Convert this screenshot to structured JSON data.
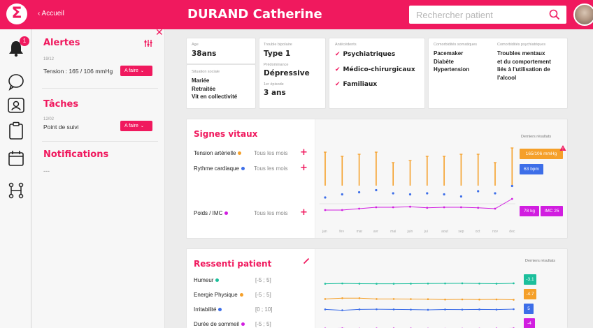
{
  "app": {
    "logo_glyph": "Σ",
    "breadcrumb": "‹ Accueil",
    "patient_name": "DURAND Catherine",
    "search_placeholder": "Rechercher patient",
    "accent_color": "#f0195e"
  },
  "rail": {
    "alert_badge": "1",
    "icons": [
      "bell-icon",
      "chat-bubble-icon",
      "contact-card-icon",
      "clipboard-icon",
      "calendar-icon",
      "pathway-icon"
    ]
  },
  "panel": {
    "close_glyph": "✕",
    "alertes_title": "Alertes",
    "alert_date": "19/12",
    "alert_text": "Tension : 165 / 106 mmHg",
    "todo_label": "A faire",
    "taches_title": "Tâches",
    "task_date": "12/02",
    "task_text": "Point de suivi",
    "notifications_title": "Notifications",
    "notifications_empty": "---"
  },
  "profile": {
    "age_label": "Age",
    "age_value": "38ans",
    "social_label": "Situation sociale",
    "social_lines": [
      "Mariée",
      "Retraitée",
      "Vit en collectivité"
    ],
    "trouble_label": "Trouble bipolaire",
    "trouble_value": "Type 1",
    "predominance_label": "Prédominance",
    "predominance_value": "Dépressive",
    "episode_label": "1er épisode",
    "episode_value": "3 ans",
    "antecedents_label": "Antécédents",
    "antecedents": [
      "Psychiatriques",
      "Médico-chirurgicaux",
      "Familiaux"
    ],
    "somatic_label": "Comorbidités somatiques",
    "somatic": [
      "Pacemaker",
      "Diabète",
      "Hypertension"
    ],
    "psych_label": "Comorbidités psychiatriques",
    "psych_lines": [
      "Troubles mentaux",
      "et du comportement",
      "liés à l'utilisation de",
      "l'alcool"
    ]
  },
  "vitals": {
    "title": "Signes vitaux",
    "latest_label": "Derniers résultats",
    "rows": [
      {
        "label": "Tension artérielle",
        "freq": "Tous les mois",
        "color": "#f5a02a"
      },
      {
        "label": "Rythme cardiaque",
        "freq": "Tous les mois",
        "color": "#3d6ee8"
      },
      {
        "label": "Poids / IMC",
        "freq": "Tous les mois",
        "color": "#d11ee0"
      }
    ],
    "plus_glyph": "+",
    "tension_tag": "165/106 mmHg",
    "heart_tag": "63 bpm",
    "weight_tag": "78 kg",
    "imc_tag": "IMC 25",
    "months": [
      "jan",
      "fev",
      "mar",
      "avr",
      "mai",
      "juin",
      "jui",
      "aout",
      "sep",
      "oct",
      "nov",
      "dec"
    ]
  },
  "ressenti": {
    "title": "Ressenti patient",
    "latest_label": "Derniers résultats",
    "rows": [
      {
        "label": "Humeur",
        "range": "[-5 ; 5]",
        "color": "#1cbf9c",
        "tag": "-3.1"
      },
      {
        "label": "Energie Physique",
        "range": "[-5 ; 5]",
        "color": "#f5a02a",
        "tag": "-4.7"
      },
      {
        "label": "Irritabilité",
        "range": "[0 ; 10]",
        "color": "#3d6ee8",
        "tag": "5"
      },
      {
        "label": "Durée de sommeil",
        "range": "[-5 ; 5]",
        "color": "#d11ee0",
        "tag": "-4"
      }
    ]
  },
  "chart_data": [
    {
      "type": "line",
      "title": "Signes vitaux",
      "categories": [
        "jan",
        "fev",
        "mar",
        "avr",
        "mai",
        "juin",
        "jui",
        "aout",
        "sep",
        "oct",
        "nov",
        "dec"
      ],
      "series": [
        {
          "name": "Tension artérielle",
          "values": [
            0.8,
            0.7,
            0.75,
            0.8,
            0.55,
            0.6,
            0.7,
            0.7,
            0.75,
            0.75,
            0.55,
            0.9
          ]
        },
        {
          "name": "Rythme cardiaque",
          "values": [
            0.1,
            0.25,
            0.35,
            0.45,
            0.3,
            0.25,
            0.3,
            0.25,
            0.15,
            0.4,
            0.3,
            0.65
          ]
        },
        {
          "name": "Poids / IMC",
          "values": [
            0.5,
            0.5,
            0.55,
            0.6,
            0.6,
            0.62,
            0.58,
            0.6,
            0.6,
            0.58,
            0.55,
            0.9
          ]
        }
      ]
    },
    {
      "type": "line",
      "title": "Ressenti patient",
      "categories": [
        "1",
        "2",
        "3",
        "4",
        "5",
        "6",
        "7",
        "8",
        "9",
        "10",
        "11",
        "12"
      ],
      "series": [
        {
          "name": "Humeur",
          "values": [
            -3.5,
            -3.2,
            -3.4,
            -3.5,
            -3.5,
            -3.4,
            -3.3,
            -3.2,
            -3.1,
            -3.3,
            -3.4,
            -3.1
          ]
        },
        {
          "name": "Energie Physique",
          "values": [
            -4.0,
            -3.3,
            -3.3,
            -4.0,
            -4.0,
            -4.1,
            -4.2,
            -4.5,
            -4.4,
            -4.5,
            -4.4,
            -4.7
          ]
        },
        {
          "name": "Irritabilité",
          "values": [
            4.8,
            4.0,
            4.8,
            4.9,
            4.8,
            4.6,
            4.4,
            4.7,
            4.6,
            4.8,
            4.6,
            5
          ]
        },
        {
          "name": "Durée de sommeil",
          "values": [
            -4.2,
            -4.0,
            -4.3,
            -4.2,
            -4.1,
            -4.2,
            -4.3,
            -4.4,
            -4.3,
            -4.3,
            -4.2,
            -4
          ]
        }
      ]
    }
  ]
}
